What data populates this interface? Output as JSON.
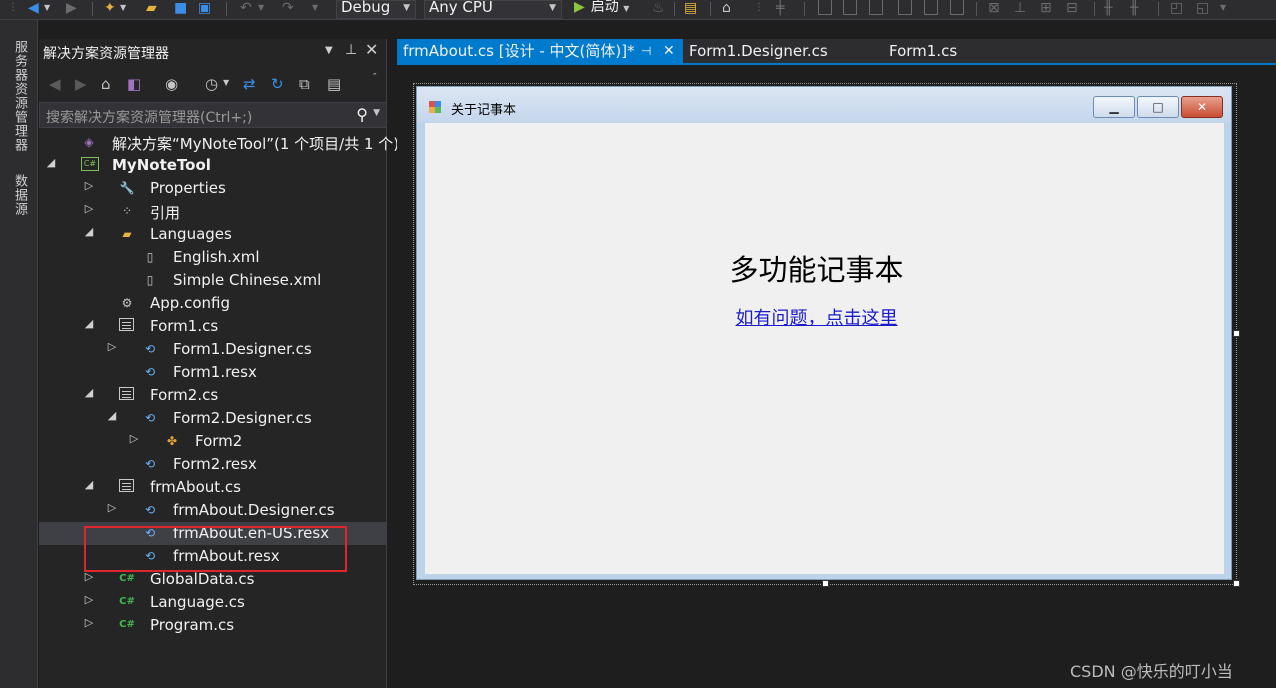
{
  "toolbar": {
    "config": "Debug",
    "platform": "Any CPU",
    "start_label": "启动"
  },
  "side_strip": {
    "tabs": [
      "服务器资源管理器",
      "数据源"
    ]
  },
  "solution_explorer": {
    "title": "解决方案资源管理器",
    "search_placeholder": "搜索解决方案资源管理器(Ctrl+;)",
    "items": [
      {
        "label": "解决方案“MyNoteTool”(1 个项目/共 1 个)",
        "icon": "solution-icon",
        "level": 0,
        "twisty": "none"
      },
      {
        "label": "MyNoteTool",
        "icon": "csharp-project-icon",
        "level": 0,
        "twisty": "expanded",
        "bold": true
      },
      {
        "label": "Properties",
        "icon": "wrench-icon",
        "level": 1,
        "twisty": "collapsed"
      },
      {
        "label": "引用",
        "icon": "references-icon",
        "level": 1,
        "twisty": "collapsed"
      },
      {
        "label": "Languages",
        "icon": "folder-open-icon",
        "level": 1,
        "twisty": "expanded"
      },
      {
        "label": "English.xml",
        "icon": "xml-file-icon",
        "level": 2,
        "twisty": "none"
      },
      {
        "label": "Simple Chinese.xml",
        "icon": "xml-file-icon",
        "level": 2,
        "twisty": "none"
      },
      {
        "label": "App.config",
        "icon": "config-file-icon",
        "level": 1,
        "twisty": "none"
      },
      {
        "label": "Form1.cs",
        "icon": "form-icon",
        "level": 1,
        "twisty": "expanded"
      },
      {
        "label": "Form1.Designer.cs",
        "icon": "cs-file-icon",
        "level": 2,
        "twisty": "collapsed"
      },
      {
        "label": "Form1.resx",
        "icon": "resx-file-icon",
        "level": 2,
        "twisty": "none"
      },
      {
        "label": "Form2.cs",
        "icon": "form-icon",
        "level": 1,
        "twisty": "expanded"
      },
      {
        "label": "Form2.Designer.cs",
        "icon": "cs-file-icon",
        "level": 2,
        "twisty": "expanded"
      },
      {
        "label": "Form2",
        "icon": "class-icon",
        "level": 3,
        "twisty": "collapsed"
      },
      {
        "label": "Form2.resx",
        "icon": "resx-file-icon",
        "level": 2,
        "twisty": "none"
      },
      {
        "label": "frmAbout.cs",
        "icon": "form-icon",
        "level": 1,
        "twisty": "expanded"
      },
      {
        "label": "frmAbout.Designer.cs",
        "icon": "cs-file-icon",
        "level": 2,
        "twisty": "collapsed"
      },
      {
        "label": "frmAbout.en-US.resx",
        "icon": "resx-file-icon",
        "level": 2,
        "twisty": "none",
        "selected": true
      },
      {
        "label": "frmAbout.resx",
        "icon": "resx-file-icon",
        "level": 2,
        "twisty": "none"
      },
      {
        "label": "GlobalData.cs",
        "icon": "csharp-file-icon",
        "level": 1,
        "twisty": "collapsed"
      },
      {
        "label": "Language.cs",
        "icon": "csharp-file-icon",
        "level": 1,
        "twisty": "collapsed"
      },
      {
        "label": "Program.cs",
        "icon": "csharp-file-icon",
        "level": 1,
        "twisty": "collapsed"
      }
    ]
  },
  "doc_tabs": [
    {
      "label": "frmAbout.cs [设计 - 中文(简体)]*",
      "active": true
    },
    {
      "label": "Form1.Designer.cs",
      "active": false
    },
    {
      "label": "Form1.cs",
      "active": false
    }
  ],
  "form": {
    "title": "关于记事本",
    "heading": "多功能记事本",
    "link": "如有问题，点击这里"
  },
  "watermark": "CSDN @快乐的叮小当",
  "colors": {
    "accent": "#007acc",
    "highlight_box": "#e0262b",
    "link": "#1a1acc"
  }
}
